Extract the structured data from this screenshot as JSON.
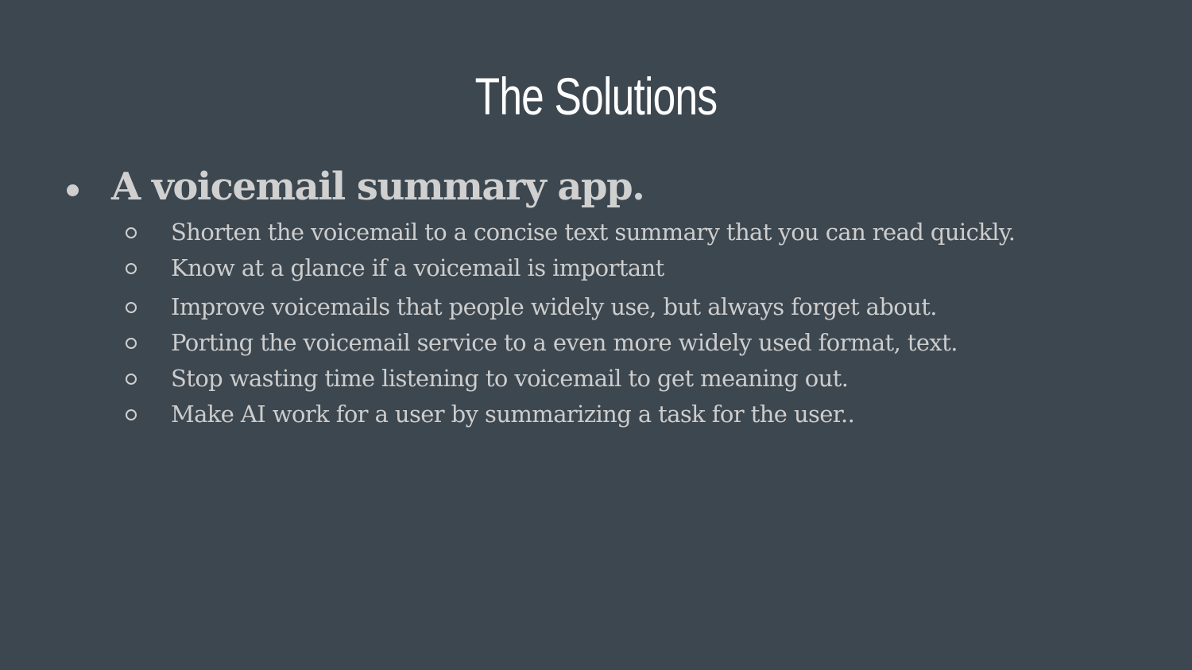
{
  "slide": {
    "title": "The Solutions",
    "main_bullet": "A voicemail summary app.",
    "sub_bullets": [
      "Shorten the voicemail to a concise text summary that you can read quickly.",
      "Know at a glance if a voicemail is important",
      "Improve voicemails that people widely use, but always forget about.",
      "Porting the voicemail service to a even more widely used format, text.",
      "Stop wasting time listening to voicemail to get meaning out.",
      "Make AI work for a user by summarizing a task for the user.."
    ]
  },
  "colors": {
    "background": "#3d474f",
    "title": "#ffffff",
    "body_text": "#cdcdcd"
  }
}
